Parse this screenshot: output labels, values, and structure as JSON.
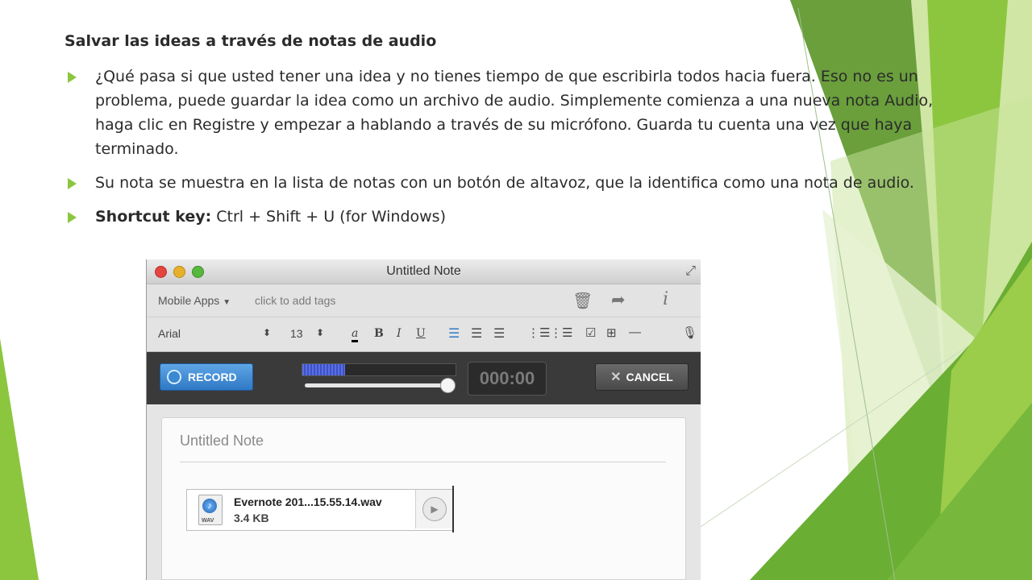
{
  "slide": {
    "title": "Salvar las ideas a través de notas de audio",
    "bullets": [
      "¿Qué pasa si que usted tener una idea y no tienes tiempo de que escribirla todos hacia fuera. Eso no es un problema, puede guardar la idea como un archivo de audio. Simplemente comienza a una nueva nota Audio, haga clic en Registre y empezar a hablando a través de su micrófono. Guarda tu cuenta una vez que haya terminado.",
      "Su nota se muestra en la lista de notas con un botón de altavoz, que la identifica como una nota de audio."
    ],
    "shortcut_label": "Shortcut key:",
    "shortcut_value": " Ctrl + Shift + U (for Windows)",
    "accent_color": "#8cc63f"
  },
  "window": {
    "title": "Untitled Note",
    "notebook": "Mobile Apps",
    "tags_placeholder": "click to add tags",
    "font": "Arial",
    "font_size": "13",
    "format_icons": {
      "underline_a": "a",
      "bold": "B",
      "italic": "I",
      "underline": "U",
      "stepper": "⬍"
    },
    "recorder": {
      "record_label": "RECORD",
      "timer": "000:00",
      "cancel_label": "CANCEL",
      "level": 0.28,
      "volume": 0.98
    },
    "note": {
      "title": "Untitled Note",
      "attachment_name": "Evernote 201...15.55.14.wav",
      "attachment_size": "3.4 KB",
      "attachment_type": "WAV"
    }
  }
}
